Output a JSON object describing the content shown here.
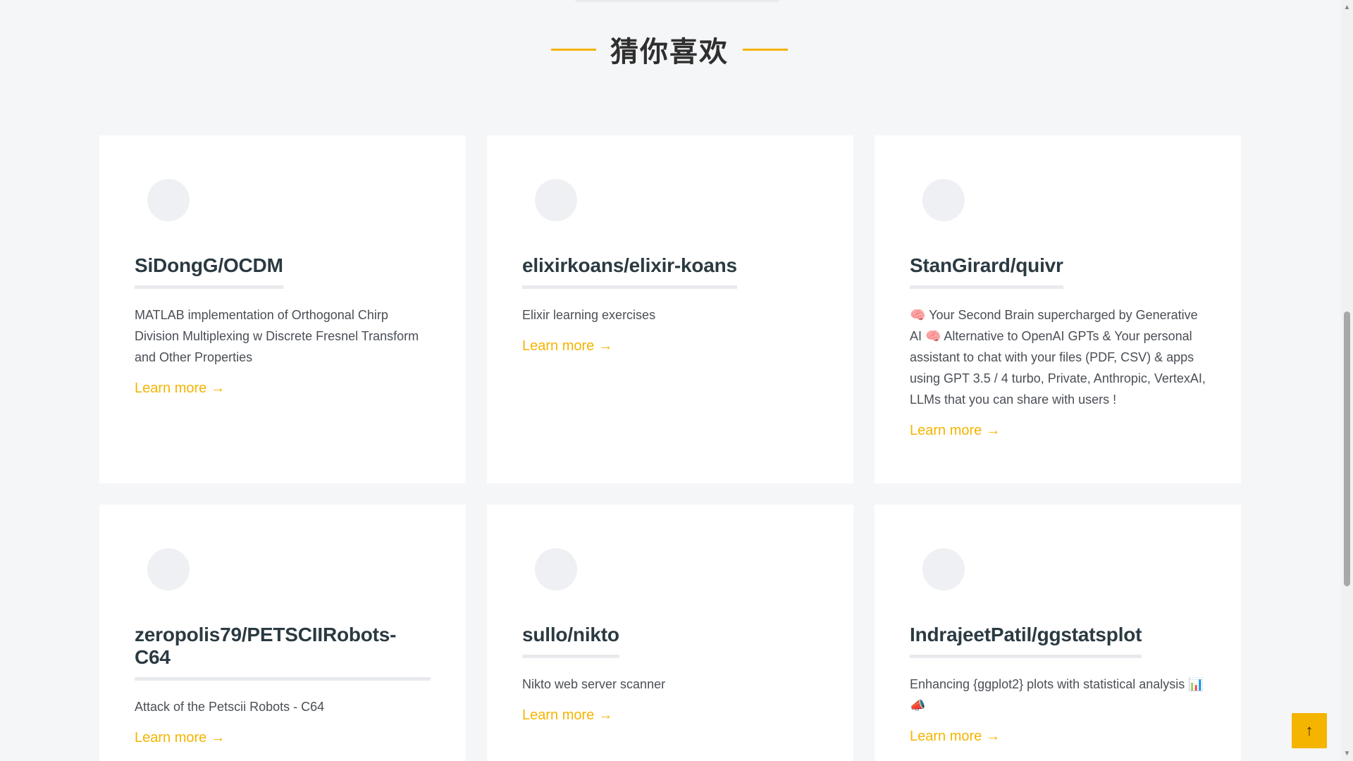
{
  "section": {
    "title": "猜你喜欢"
  },
  "colors": {
    "accent": "#f5b400",
    "background": "#f5f6f8",
    "card": "#ffffff"
  },
  "cards": [
    {
      "name": "SiDongG/OCDM",
      "description": "MATLAB implementation of Orthogonal Chirp Division Multiplexing w Discrete Fresnel Transform and Other Properties",
      "link_label": "Learn more",
      "link_icon": "→"
    },
    {
      "name": "elixirkoans/elixir-koans",
      "description": "Elixir learning exercises",
      "link_label": "Learn more",
      "link_icon": "→"
    },
    {
      "name": "StanGirard/quivr",
      "description": "🧠 Your Second Brain supercharged by Generative AI 🧠 Alternative to OpenAI GPTs & Your personal assistant to chat with your files (PDF, CSV) & apps using GPT 3.5 / 4 turbo, Private, Anthropic, VertexAI, LLMs that you can share with users !",
      "link_label": "Learn more",
      "link_icon": "→"
    },
    {
      "name": "zeropolis79/PETSCIIRobots-C64",
      "description": "Attack of the Petscii Robots - C64",
      "link_label": "Learn more",
      "link_icon": "→"
    },
    {
      "name": "sullo/nikto",
      "description": "Nikto web server scanner",
      "link_label": "Learn more",
      "link_icon": "→"
    },
    {
      "name": "IndrajeetPatil/ggstatsplot",
      "description": "Enhancing {ggplot2} plots with statistical analysis 📊📣",
      "link_label": "Learn more",
      "link_icon": "→"
    }
  ],
  "back_to_top": {
    "icon": "↑"
  },
  "scrollbar": {
    "up_icon": "▲",
    "down_icon": "▼"
  }
}
